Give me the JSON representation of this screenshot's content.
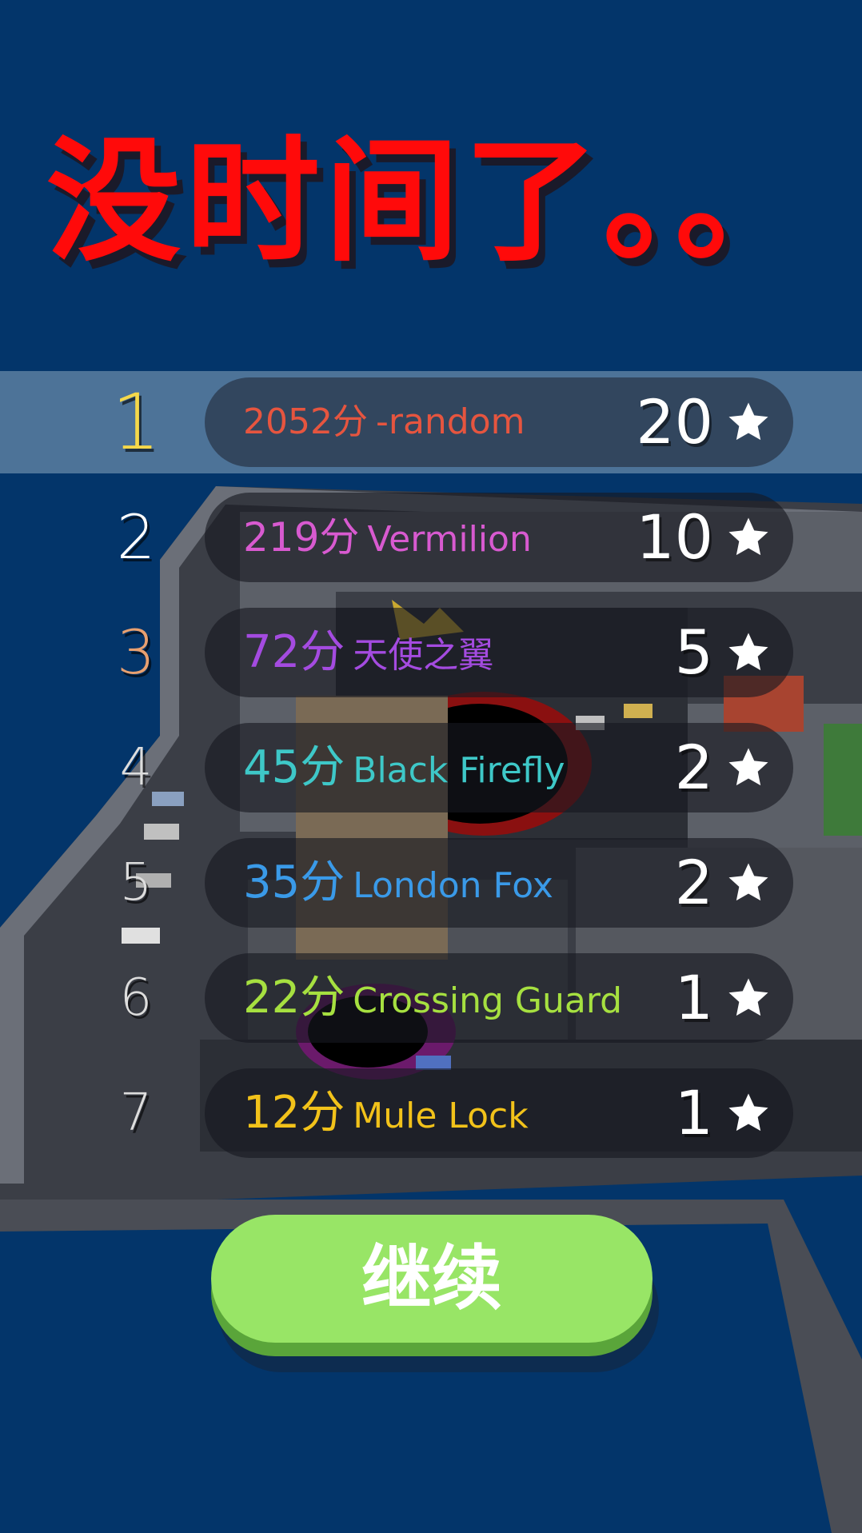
{
  "title": "没时间了。。",
  "leaderboard": [
    {
      "rank": "1",
      "points": "2052分",
      "name": "-random",
      "stars": "20",
      "color": "#e6553f",
      "rank_color": "#f5d84a"
    },
    {
      "rank": "2",
      "points": "219分",
      "name": "Vermilion",
      "stars": "10",
      "color": "#d85ad0",
      "rank_color": "#ffffff"
    },
    {
      "rank": "3",
      "points": "72分",
      "name": "天使之翼",
      "stars": "5",
      "color": "#a44be0",
      "rank_color": "#e8a070"
    },
    {
      "rank": "4",
      "points": "45分",
      "name": "Black Firefly",
      "stars": "2",
      "color": "#3ec8c8",
      "rank_color": "#dddddd"
    },
    {
      "rank": "5",
      "points": "35分",
      "name": "London Fox",
      "stars": "2",
      "color": "#3a9ae8",
      "rank_color": "#dddddd"
    },
    {
      "rank": "6",
      "points": "22分",
      "name": "Crossing Guard",
      "stars": "1",
      "color": "#a6e040",
      "rank_color": "#dddddd"
    },
    {
      "rank": "7",
      "points": "12分",
      "name": "Mule Lock",
      "stars": "1",
      "color": "#f2c21a",
      "rank_color": "#dddddd"
    }
  ],
  "icons": {
    "star": "star-icon"
  },
  "continue_label": "继续",
  "colors": {
    "background": "#03356a",
    "title": "#ff0a0a",
    "button": "#98e566"
  }
}
